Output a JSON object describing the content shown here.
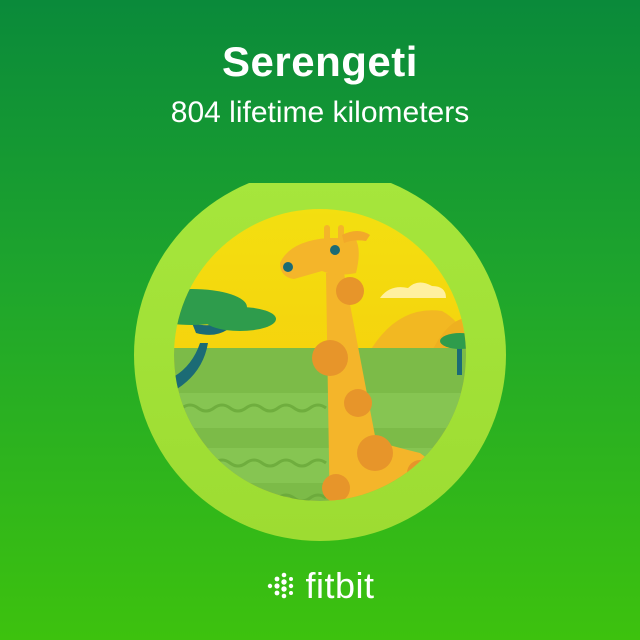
{
  "badge": {
    "title": "Serengeti",
    "subtitle": "804 lifetime kilometers",
    "illustration_icon": "giraffe-savanna-icon"
  },
  "brand": {
    "name": "fitbit",
    "logo_icon": "fitbit-dots-icon"
  },
  "colors": {
    "background_top": "#0a8a3a",
    "background_bottom": "#3dc20e",
    "badge_ring": "#a4e83a",
    "sky": "#f5d60a",
    "grass": "#78bb45",
    "giraffe": "#f4b52a",
    "giraffe_spot": "#e7952a",
    "tree": "#2d9a4b"
  }
}
